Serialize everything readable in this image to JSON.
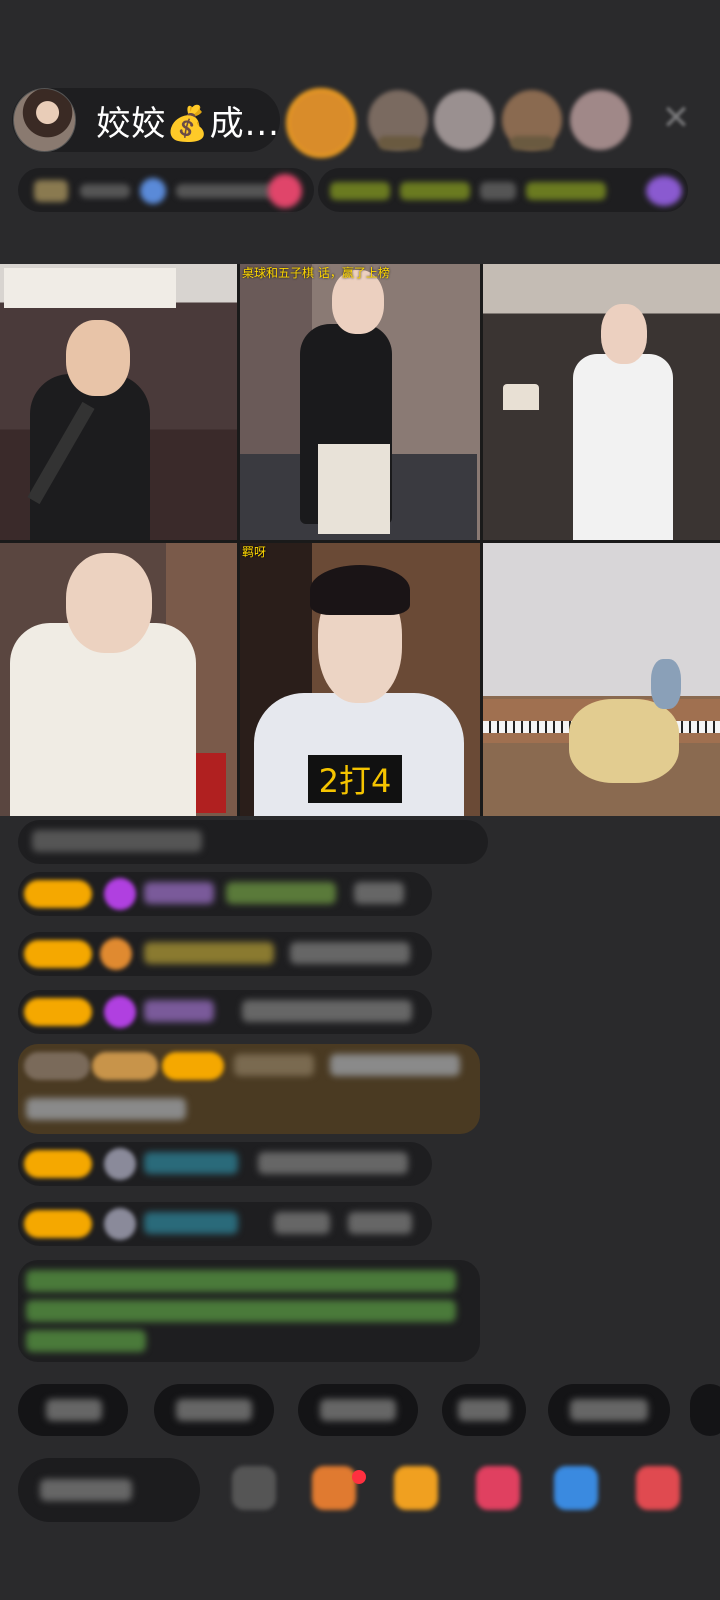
{
  "host": {
    "name": "姣姣💰成..."
  },
  "video_tiles": [
    {
      "label": ""
    },
    {
      "label": "桌球和五子棋 话，赢了上榜"
    },
    {
      "label": ""
    },
    {
      "label": ""
    },
    {
      "label": "羁呀"
    },
    {
      "label": ""
    }
  ],
  "score_badge": "2打4",
  "colors": {
    "background": "#2a2a2c",
    "pill": "#1e1e20",
    "badge_yellow": "#f5a800",
    "score_text": "#f5c400"
  }
}
